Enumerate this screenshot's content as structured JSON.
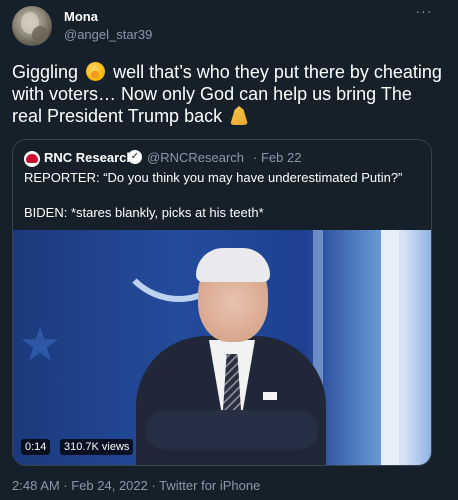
{
  "user": {
    "name": "Mona",
    "handle": "@angel_star39",
    "more": "···"
  },
  "text": {
    "part1": "Giggling",
    "part2": "well that’s who they put there by cheating with voters… Now only God can help us bring The real President Trump back",
    "emoji1": "face-with-hand-over-mouth",
    "emoji2": "folded-hands"
  },
  "quote": {
    "name": "RNC Research",
    "verified_mark": "✓",
    "handle": "@RNCResearch",
    "dot": "·",
    "date": "Feb 22",
    "line1": "REPORTER: “Do you think you may have underestimated Putin?”",
    "line2": "BIDEN: *stares blankly, picks at his teeth*",
    "video": {
      "time": "0:14",
      "views": "310.7K views"
    }
  },
  "footer": {
    "timestamp": "2:48 AM · Feb 24, 2022 · Twitter for iPhone"
  },
  "colors": {
    "background": "#15202b",
    "secondary": "#8b98a5",
    "border": "#38444d"
  }
}
